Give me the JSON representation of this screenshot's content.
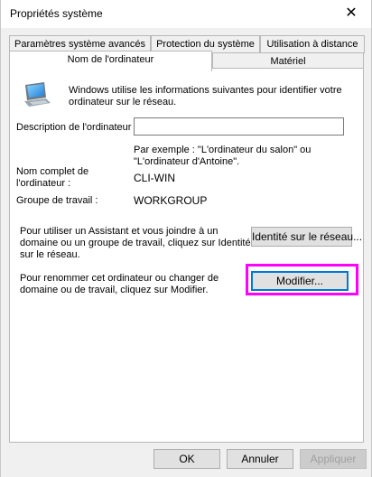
{
  "window": {
    "title": "Propriétés système"
  },
  "tabs_back": [
    {
      "label": "Paramètres système avancés"
    },
    {
      "label": "Protection du système"
    },
    {
      "label": "Utilisation à distance"
    }
  ],
  "tabs_front": [
    {
      "label": "Nom de l'ordinateur"
    },
    {
      "label": "Matériel"
    }
  ],
  "main": {
    "intro_line1": "Windows utilise les informations suivantes pour identifier votre",
    "intro_line2": "ordinateur sur le réseau.",
    "description_label": "Description de l'ordinateur :",
    "description_value": "",
    "example_line1": "Par exemple : \"L'ordinateur du salon\" ou",
    "example_line2": "\"L'ordinateur d'Antoine\".",
    "fullname_label_line1": "Nom complet de",
    "fullname_label_line2": "l'ordinateur :",
    "fullname_value": "CLI-WIN",
    "workgroup_label": "Groupe de travail :",
    "workgroup_value": "WORKGROUP",
    "network_text_line1": "Pour utiliser un Assistant et vous joindre à un",
    "network_text_line2": "domaine ou un groupe de travail, cliquez sur Identité",
    "network_text_line3": "sur le réseau.",
    "network_button": "Identité sur le réseau...",
    "rename_text_line1": "Pour renommer cet ordinateur ou changer de",
    "rename_text_line2": "domaine ou de travail, cliquez sur Modifier.",
    "rename_button": "Modifier..."
  },
  "footer": {
    "ok": "OK",
    "cancel": "Annuler",
    "apply": "Appliquer"
  },
  "colors": {
    "highlight": "#ff00ff",
    "focus": "#0078d7"
  },
  "icons": {
    "computer": "computer-monitor-icon",
    "close": "close-icon"
  }
}
